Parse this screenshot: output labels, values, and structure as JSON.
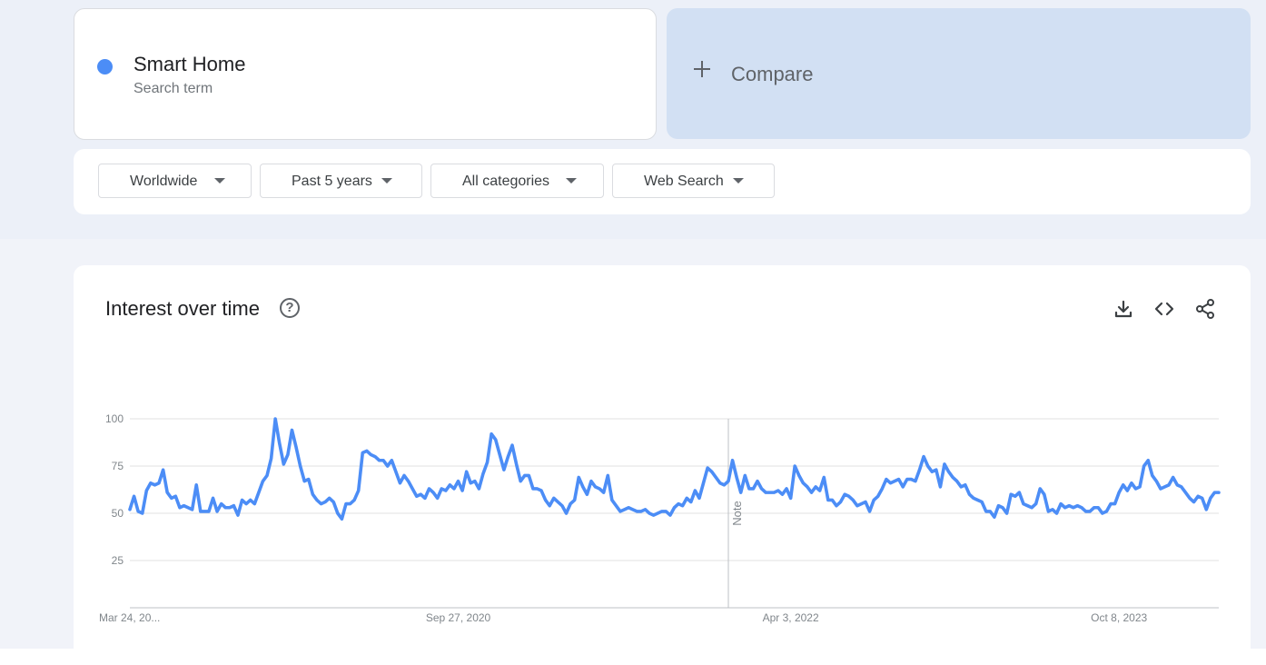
{
  "colors": {
    "series": "#4c8df6",
    "grid": "#e0e0e0",
    "compare_bg": "#d2e0f3"
  },
  "search_term": {
    "name": "Smart Home",
    "type": "Search term"
  },
  "compare": {
    "label": "Compare",
    "icon": "plus-icon"
  },
  "filters": {
    "region": "Worldwide",
    "time_range": "Past 5 years",
    "category": "All categories",
    "search_type": "Web Search"
  },
  "chart_section": {
    "title": "Interest over time",
    "help_icon": "help-icon",
    "tools": [
      "download-icon",
      "embed-code-icon",
      "share-icon"
    ]
  },
  "chart_data": {
    "type": "line",
    "title": "",
    "xlabel": "",
    "ylabel": "",
    "ylim": [
      0,
      100
    ],
    "y_ticks": [
      "100",
      "75",
      "50",
      "25"
    ],
    "x_tick_labels": [
      "Mar 24, 20...",
      "Sep 27, 2020",
      "Apr 3, 2022",
      "Oct 8, 2023"
    ],
    "x_tick_indices": [
      0,
      79,
      159,
      238
    ],
    "annotation": {
      "label": "Note",
      "at_index": 144
    },
    "grid": true,
    "series": [
      {
        "name": "Smart Home",
        "values": [
          52,
          59,
          51,
          50,
          62,
          66,
          65,
          66,
          73,
          61,
          58,
          59,
          53,
          54,
          53,
          52,
          65,
          51,
          51,
          51,
          58,
          51,
          55,
          53,
          53,
          54,
          49,
          57,
          55,
          57,
          55,
          61,
          67,
          70,
          79,
          100,
          87,
          76,
          81,
          94,
          85,
          75,
          67,
          68,
          60,
          57,
          55,
          56,
          58,
          56,
          50,
          47,
          55,
          55,
          57,
          62,
          82,
          83,
          81,
          80,
          78,
          78,
          75,
          78,
          72,
          66,
          70,
          67,
          63,
          59,
          60,
          58,
          63,
          61,
          58,
          63,
          62,
          65,
          63,
          67,
          62,
          72,
          66,
          67,
          63,
          71,
          77,
          92,
          89,
          81,
          73,
          80,
          86,
          76,
          67,
          70,
          70,
          63,
          63,
          62,
          57,
          54,
          58,
          56,
          54,
          50,
          55,
          57,
          69,
          64,
          60,
          67,
          64,
          63,
          61,
          70,
          57,
          54,
          51,
          52,
          53,
          52,
          51,
          51,
          52,
          50,
          49,
          50,
          51,
          51,
          49,
          53,
          55,
          54,
          58,
          56,
          62,
          58,
          66,
          74,
          72,
          69,
          66,
          65,
          67,
          78,
          69,
          61,
          70,
          63,
          63,
          67,
          63,
          61,
          61,
          61,
          62,
          60,
          63,
          58,
          75,
          70,
          66,
          64,
          61,
          64,
          62,
          69,
          57,
          57,
          54,
          56,
          60,
          59,
          57,
          54,
          55,
          56,
          51,
          57,
          59,
          63,
          68,
          66,
          67,
          68,
          64,
          68,
          68,
          67,
          73,
          80,
          75,
          72,
          73,
          64,
          76,
          72,
          69,
          67,
          64,
          65,
          60,
          58,
          57,
          56,
          51,
          51,
          48,
          54,
          53,
          50,
          60,
          59,
          61,
          55,
          54,
          53,
          55,
          63,
          60,
          51,
          52,
          50,
          55,
          53,
          54,
          53,
          54,
          53,
          51,
          51,
          53,
          53,
          50,
          51,
          55,
          55,
          61,
          65,
          62,
          66,
          63,
          64,
          75,
          78,
          70,
          67,
          63,
          64,
          65,
          69,
          65,
          64,
          61,
          58,
          56,
          59,
          58,
          52,
          58,
          61,
          61
        ]
      }
    ]
  }
}
